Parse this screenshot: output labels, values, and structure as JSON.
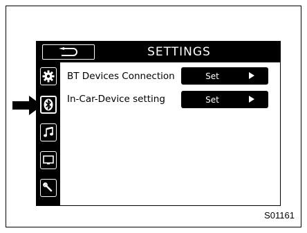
{
  "header": {
    "title": "SETTINGS"
  },
  "sidebar": {
    "items": [
      {
        "icon": "gear-icon"
      },
      {
        "icon": "bluetooth-icon",
        "active": true
      },
      {
        "icon": "music-note-icon"
      },
      {
        "icon": "display-icon"
      },
      {
        "icon": "wrench-icon"
      }
    ]
  },
  "rows": [
    {
      "label": "BT Devices Connection",
      "button": "Set"
    },
    {
      "label": "In-Car-Device setting",
      "button": "Set"
    }
  ],
  "figure_id": "S01161",
  "colors": {
    "screen_bg": "#ffffff",
    "ui_black": "#000000",
    "ui_white": "#ffffff"
  }
}
